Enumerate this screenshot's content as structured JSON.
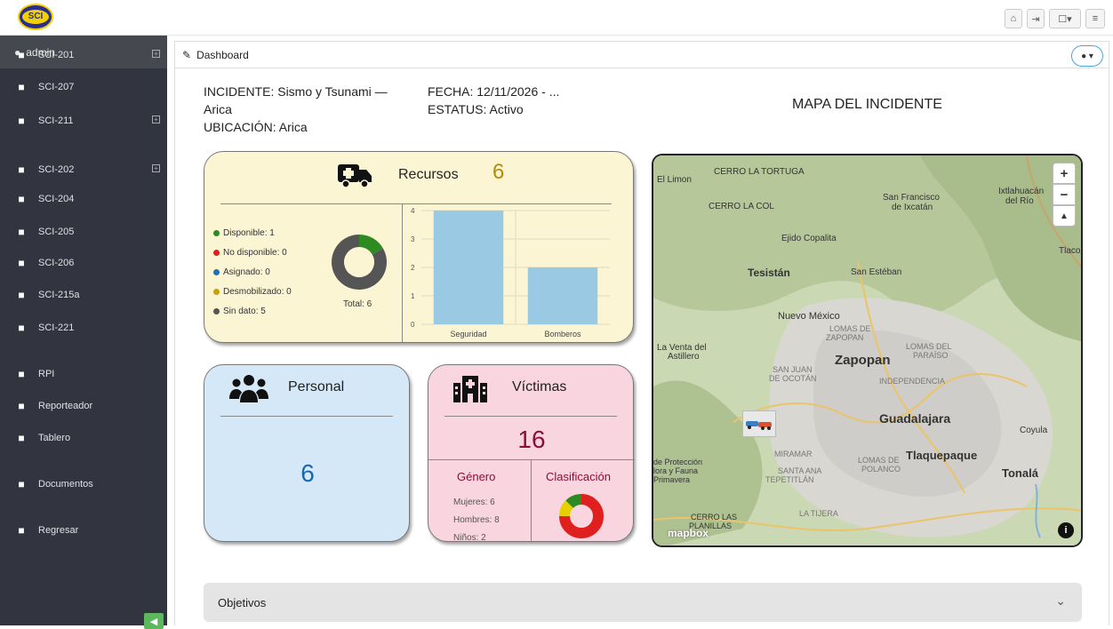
{
  "sidebar": {
    "user": "admin",
    "items": [
      {
        "label": "SCI-201",
        "icon": "list-icon",
        "expand": "true"
      },
      {
        "label": "SCI-207",
        "icon": "stethoscope-icon",
        "expand": "false"
      },
      {
        "label": "SCI-211",
        "icon": "table-icon",
        "expand": "true"
      },
      {
        "label": "SCI-202",
        "icon": "sort-list-icon",
        "expand": "true"
      },
      {
        "label": "SCI-204",
        "icon": "compass-icon",
        "expand": "false"
      },
      {
        "label": "SCI-205",
        "icon": "rss-icon",
        "expand": "false"
      },
      {
        "label": "SCI-206",
        "icon": "sitemap-icon",
        "expand": "false"
      },
      {
        "label": "SCI-215a",
        "icon": "checkbox-icon",
        "expand": "false"
      },
      {
        "label": "SCI-221",
        "icon": "th-large-icon",
        "expand": "false"
      },
      {
        "label": "RPI",
        "icon": "file-icon",
        "expand": "false"
      },
      {
        "label": "Reporteador",
        "icon": "copy-icon",
        "expand": "false"
      },
      {
        "label": "Tablero",
        "icon": "list-alt-icon",
        "expand": "false"
      },
      {
        "label": "Documentos",
        "icon": "file-icon",
        "expand": "false"
      },
      {
        "label": "Regresar",
        "icon": "arrow-left-icon",
        "expand": "false"
      }
    ]
  },
  "header": {
    "logo_text": "SCI",
    "breadcrumb": "Dashboard"
  },
  "incident": {
    "incidente_l1": "INCIDENTE: Sismo y Tsunami —",
    "incidente_l2": "Arica",
    "ubicacion": "UBICACIÓN: Arica",
    "fecha": "FECHA: 12/11/2026 - ...",
    "estatus": "ESTATUS: Activo"
  },
  "map_title": "MAPA DEL INCIDENTE",
  "recursos": {
    "title": "Recursos",
    "count": "6",
    "total": "Total: 6",
    "legend": [
      {
        "label": "Disponible: 1",
        "color": "#2e8b22"
      },
      {
        "label": "No disponible: 0",
        "color": "#e0201e"
      },
      {
        "label": "Asignado: 0",
        "color": "#1f6fb5"
      },
      {
        "label": "Desmobilizado: 0",
        "color": "#c8a000"
      },
      {
        "label": "Sin dato: 5",
        "color": "#555555"
      }
    ],
    "donut": [
      1,
      0,
      0,
      0,
      5
    ]
  },
  "chart_data": {
    "type": "bar",
    "categories": [
      "Seguridad",
      "Bomberos"
    ],
    "values": [
      4,
      2
    ],
    "ylim": [
      0,
      4
    ],
    "yticks": [
      "0",
      "1",
      "2",
      "3",
      "4"
    ],
    "color": "#99c9e3",
    "grid": true
  },
  "personal": {
    "title": "Personal",
    "count": "6"
  },
  "victimas": {
    "title": "Víctimas",
    "count": "16",
    "genero_label": "Género",
    "clasificacion_label": "Clasificación",
    "genero": [
      "Mujeres: 6",
      "Hombres: 8",
      "Niños: 2"
    ],
    "clasificacion": [
      {
        "value": 12,
        "color": "#e0201e"
      },
      {
        "value": 2,
        "color": "#e8d000"
      },
      {
        "value": 2,
        "color": "#2e8b22"
      }
    ]
  },
  "map": {
    "labels": [
      {
        "text": "CERRO LA TORTUGA"
      },
      {
        "text": "El Limon"
      },
      {
        "text": "CERRO LA COL"
      },
      {
        "text": "San Francisco"
      },
      {
        "text": "de Ixcatán"
      },
      {
        "text": "Ixtlahuacán"
      },
      {
        "text": "del Río"
      },
      {
        "text": "Ejido Copalita"
      },
      {
        "text": "Tesistán"
      },
      {
        "text": "San Estéban"
      },
      {
        "text": "Tlaco"
      },
      {
        "text": "Nuevo México"
      },
      {
        "text": "LOMAS DE"
      },
      {
        "text": "ZAPOPAN"
      },
      {
        "text": "La Venta del"
      },
      {
        "text": "Astillero"
      },
      {
        "text": "SAN JUAN"
      },
      {
        "text": "DE OCOTÁN"
      },
      {
        "text": "Zapopan"
      },
      {
        "text": "LOMAS DEL"
      },
      {
        "text": "PARAÍSO"
      },
      {
        "text": "INDEPENDENCIA"
      },
      {
        "text": "Guadalajara"
      },
      {
        "text": "Coyula"
      },
      {
        "text": "MIRAMAR"
      },
      {
        "text": "LOMAS DE"
      },
      {
        "text": "POLANCO"
      },
      {
        "text": "Tlaquepaque"
      },
      {
        "text": "SANTA ANA"
      },
      {
        "text": "TEPETITLÁN"
      },
      {
        "text": "Tonalá"
      },
      {
        "text": "de Protección"
      },
      {
        "text": "lora y Fauna"
      },
      {
        "text": "Primavera"
      },
      {
        "text": "LA TIJERA"
      },
      {
        "text": "CERRO LAS"
      },
      {
        "text": "PLANILLAS"
      },
      {
        "text": "mapbox"
      }
    ]
  },
  "objetivos": "Objetivos"
}
